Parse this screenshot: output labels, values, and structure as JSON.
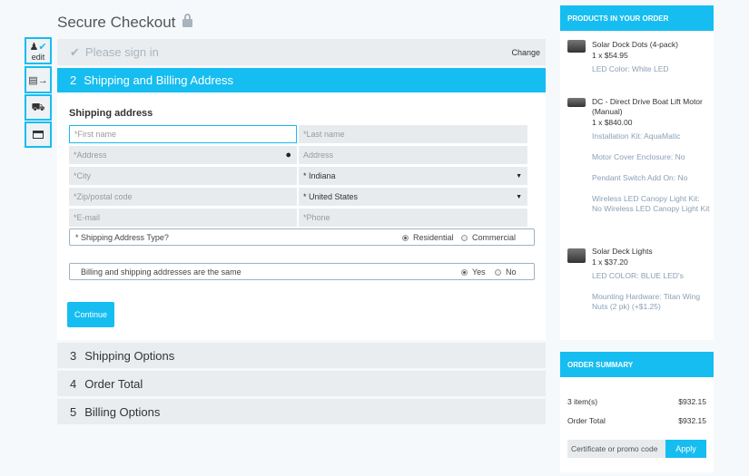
{
  "header": {
    "title": "Secure Checkout",
    "icon": "lock-icon"
  },
  "steps_nav": [
    {
      "icon": "user-icon",
      "label": "edit",
      "done": true
    },
    {
      "icon": "id-card-icon"
    },
    {
      "icon": "truck-icon"
    },
    {
      "icon": "credit-card-icon"
    }
  ],
  "sign_in": {
    "label": "Please sign in",
    "change": "Change"
  },
  "active": {
    "number": "2",
    "label": "Shipping and Billing Address"
  },
  "form": {
    "heading": "Shipping address",
    "first_name": "*First name",
    "last_name": "*Last name",
    "address": "*Address",
    "address2": "Address",
    "city": "*City",
    "state": "* Indiana",
    "zip": "*Zip/postal code",
    "country": "* United States",
    "email": "*E-mail",
    "phone": "*Phone",
    "type_label": "* Shipping Address Type?",
    "residential": "Residential",
    "commercial": "Commercial",
    "type_selected": "Residential",
    "same_label": "Billing and shipping addresses are the same",
    "yes": "Yes",
    "no": "No",
    "same_selected": "Yes",
    "continue": "Continue"
  },
  "sections": [
    {
      "number": "3",
      "label": "Shipping Options"
    },
    {
      "number": "4",
      "label": "Order Total"
    },
    {
      "number": "5",
      "label": "Billing Options"
    }
  ],
  "products": {
    "title": "PRODUCTS IN YOUR ORDER",
    "items": [
      {
        "name": "Solar Dock Dots (4-pack)",
        "price": "1 x $54.95",
        "options": [
          "LED Color: White LED"
        ]
      },
      {
        "name": "DC - Direct Drive Boat Lift Motor (Manual)",
        "price": "1 x $840.00",
        "options": [
          "Installation Kit: AquaMatic",
          "Motor Cover Enclosure: No",
          "Pendant Switch Add On: No",
          "Wireless LED Canopy Light Kit: No Wireless LED Canopy Light Kit"
        ]
      },
      {
        "name": "Solar Deck Lights",
        "price": "1 x $37.20",
        "options": [
          "LED COLOR: BLUE LED's",
          "Mounting Hardware: Titan Wing Nuts (2 pk) (+$1.25)"
        ]
      }
    ]
  },
  "summary": {
    "title": "ORDER SUMMARY",
    "items_label": "3 item(s)",
    "items_value": "$932.15",
    "total_label": "Order Total",
    "total_value": "$932.15",
    "promo_placeholder": "Certificate or promo code",
    "apply": "Apply"
  },
  "colors": {
    "accent": "#16bdf0"
  }
}
